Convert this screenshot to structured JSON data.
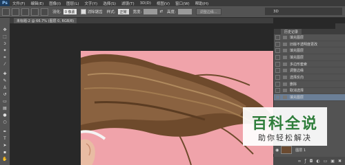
{
  "app": {
    "logo": "Ps"
  },
  "menu": [
    "文件(F)",
    "编辑(E)",
    "图像(I)",
    "图层(L)",
    "文字(Y)",
    "选择(S)",
    "滤镜(T)",
    "3D(D)",
    "视图(V)",
    "窗口(W)",
    "帮助(H)"
  ],
  "options": {
    "feather_label": "羽化:",
    "feather_value": "0 像素",
    "antialias_label": "消除锯齿",
    "style_label": "样式:",
    "style_value": "正常",
    "width_label": "宽度:",
    "height_label": "高度:",
    "refine_button": "调整边缘..."
  },
  "workspace": {
    "value": "3D"
  },
  "document_tab": {
    "label": "未标题-2 @ 66.7% (图层 0, RGB/8)"
  },
  "history_panel": {
    "tab_label": "历史记录",
    "items": [
      "填充图层",
      "旧版不透明度更改",
      "填充图层",
      "填充图层",
      "多边形套索",
      "调整边缘",
      "选择反向",
      "删除",
      "取消选择",
      "填充图层"
    ],
    "active_index": 9
  },
  "layers": {
    "layer_label": "图层 1"
  },
  "watermark": {
    "title": "百科全说",
    "subtitle": "助你轻松解决"
  },
  "colors": {
    "canvas_background": "#f0a3aa",
    "hair": "#6b4a30",
    "watermark_title": "#2e7d3a"
  },
  "tools": [
    "move-icon",
    "marquee-icon",
    "lasso-icon",
    "magic-wand-icon",
    "crop-icon",
    "eyedropper-icon",
    "healing-brush-icon",
    "brush-icon",
    "clone-stamp-icon",
    "history-brush-icon",
    "eraser-icon",
    "gradient-icon",
    "blur-icon",
    "dodge-icon",
    "pen-icon",
    "type-icon",
    "path-selection-icon",
    "shape-icon",
    "hand-icon",
    "zoom-icon"
  ]
}
